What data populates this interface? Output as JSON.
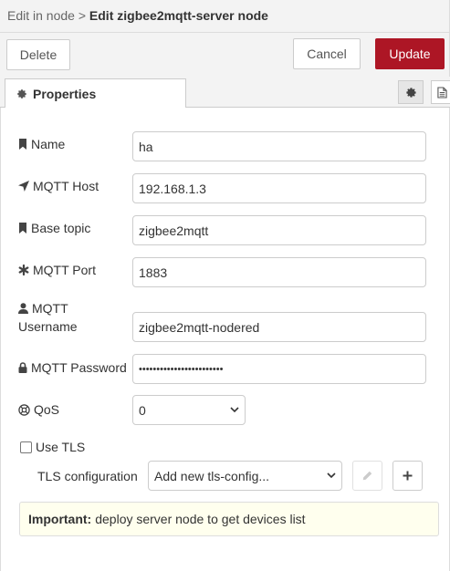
{
  "header": {
    "breadcrumb_parent": "Edit in node",
    "breadcrumb_separator": ">",
    "breadcrumb_current": "Edit zigbee2mqtt-server node"
  },
  "toolbar": {
    "delete_label": "Delete",
    "cancel_label": "Cancel",
    "update_label": "Update",
    "update_color": "#ad1625"
  },
  "tabs": {
    "properties_label": "Properties",
    "properties_icon": "gear-icon",
    "settings_icon": "gear-icon",
    "description_icon": "file-icon"
  },
  "form": {
    "name": {
      "label": "Name",
      "icon": "bookmark-icon",
      "value": "ha"
    },
    "mqtt_host": {
      "label": "MQTT Host",
      "icon": "location-arrow-icon",
      "value": "192.168.1.3"
    },
    "base_topic": {
      "label": "Base topic",
      "icon": "bookmark-icon",
      "value": "zigbee2mqtt"
    },
    "mqtt_port": {
      "label": "MQTT Port",
      "icon": "asterisk-icon",
      "value": "1883"
    },
    "mqtt_username": {
      "label_line1": "MQTT",
      "label_line2": "Username",
      "icon": "user-icon",
      "value": "zigbee2mqtt-nodered"
    },
    "mqtt_password": {
      "label": "MQTT Password",
      "icon": "lock-icon",
      "value": "••••••••••••••••••••••••"
    },
    "qos": {
      "label": "QoS",
      "icon": "life-ring-icon",
      "selected": "0"
    },
    "use_tls": {
      "label": "Use TLS",
      "checked": false
    },
    "tls_configuration": {
      "label": "TLS configuration",
      "selected": "Add new tls-config..."
    }
  },
  "notice": {
    "strong": "Important:",
    "text": "deploy server node to get devices list",
    "background": "#ffffee"
  }
}
